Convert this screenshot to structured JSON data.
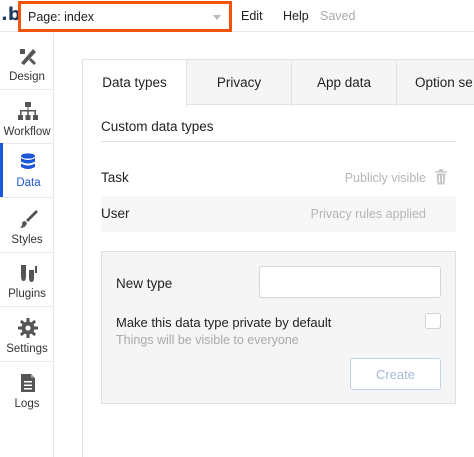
{
  "topbar": {
    "logo": ".b",
    "page_select": "Page: index",
    "menu": [
      "Edit",
      "Help"
    ],
    "status": "Saved"
  },
  "sidebar": {
    "items": [
      {
        "label": "Design",
        "icon": "design-icon"
      },
      {
        "label": "Workflow",
        "icon": "workflow-icon"
      },
      {
        "label": "Data",
        "icon": "data-icon",
        "active": true
      },
      {
        "label": "Styles",
        "icon": "styles-icon"
      },
      {
        "label": "Plugins",
        "icon": "plugins-icon"
      },
      {
        "label": "Settings",
        "icon": "settings-icon"
      },
      {
        "label": "Logs",
        "icon": "logs-icon"
      }
    ]
  },
  "main": {
    "tabs": [
      {
        "label": "Data types",
        "active": true
      },
      {
        "label": "Privacy"
      },
      {
        "label": "App data"
      },
      {
        "label": "Option se"
      }
    ],
    "section_title": "Custom data types",
    "data_types": [
      {
        "name": "Task",
        "status": "Publicly visible",
        "icon": "trash-icon"
      },
      {
        "name": "User",
        "status": "Privacy rules applied"
      }
    ],
    "new_type": {
      "label": "New type",
      "input_value": "",
      "private_label": "Make this data type private by default",
      "private_hint": "Things will be visible to everyone",
      "private_checked": false,
      "create_button": "Create"
    }
  },
  "colors": {
    "accent": "#1c56d9",
    "highlight_border": "#f4530b"
  }
}
